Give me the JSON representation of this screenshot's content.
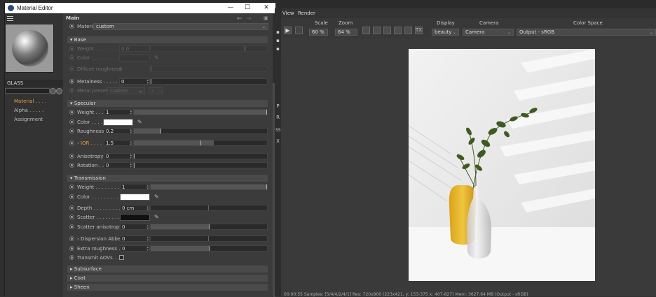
{
  "editor": {
    "title": "Material Editor",
    "minimize_glyph": "—",
    "maximize_glyph": "☐",
    "close_glyph": "✕",
    "material_name": "GLASS",
    "nav": [
      "Material . . . .",
      "Alpha . . . . .",
      "Assignment"
    ],
    "main_title": "Main",
    "material_label": "Material",
    "material_value": "custom",
    "base": {
      "header": "Base",
      "weight_label": "Weight . . . . . . . .",
      "weight_value": "0.0",
      "color_label": "Color . . . . . . . . .",
      "diffuse_label": "Diffuse roughness",
      "diffuse_value": "0",
      "metalness_label": "Metalness . . . . .",
      "metalness_value": "0",
      "presets_label": "Metal presets",
      "presets_value": "custom"
    },
    "specular": {
      "header": "Specular",
      "weight_label": "Weight . . . . . . . .",
      "weight_value": "1",
      "color_label": "Color . . . . . . . . .",
      "roughness_label": "Roughness . . .",
      "roughness_value": "0.2",
      "ior_label": "IOR . . . . . . .",
      "ior_value": "1.5",
      "anisotropy_label": "Anisotropy . . . .",
      "anisotropy_value": "0",
      "rotation_label": "Rotation . . . . . . .",
      "rotation_value": "0"
    },
    "transmission": {
      "header": "Transmission",
      "weight_label": "Weight . . . . . . . .",
      "weight_value": "1",
      "color_label": "Color . . . . . . . . .",
      "depth_label": "Depth . . . . . . . . .",
      "depth_value": "0 cm",
      "scatter_label": "Scatter . . . . . . . .",
      "scatter_aniso_label": "Scatter anisotropy",
      "scatter_aniso_value": "0",
      "dispersion_label": "Dispersion Abbe",
      "dispersion_value": "0",
      "extra_rough_label": "Extra roughness . .",
      "extra_rough_value": "0",
      "aovs_label": "Transmit AOVs . . ."
    },
    "collapsed_sections": [
      "Subsurface",
      "Coat",
      "Sheen"
    ]
  },
  "viewer": {
    "menu": [
      "View",
      "Render"
    ],
    "scale_label": "Scale",
    "scale_value": "60 %",
    "zoom_label": "Zoom",
    "zoom_value": "64 %",
    "display_label": "Display",
    "display_value": "beauty",
    "camera_label": "Camera",
    "camera_value": "Camera",
    "colorspace_label": "Color Space",
    "colorspace_value": "Output - sRGB",
    "tx_label": "TX",
    "status": "00:00:55  Samples: [5/4/4/2/4/1]  Res: 720x900 (223x421, y: 153-375 x: 407-827)  Mem: 3627.64 MB  (Output - sRGB)"
  },
  "vstrip_letters": [
    "P",
    "R",
    "SS",
    "X"
  ],
  "colors": {
    "accent": "#e8a040",
    "white_swatch": "#ffffff",
    "black_swatch": "#111111",
    "slider_marker": "#9bb0d8",
    "vase_yellow": "#e8b830"
  },
  "slider_levels": {
    "base_weight": 0.0,
    "metalness": 0.0,
    "spec_weight": 1.0,
    "roughness": 0.2,
    "ior": 0.6,
    "trans_weight": 1.0,
    "scatter_aniso": 0.5,
    "extra_rough": 0.5
  }
}
